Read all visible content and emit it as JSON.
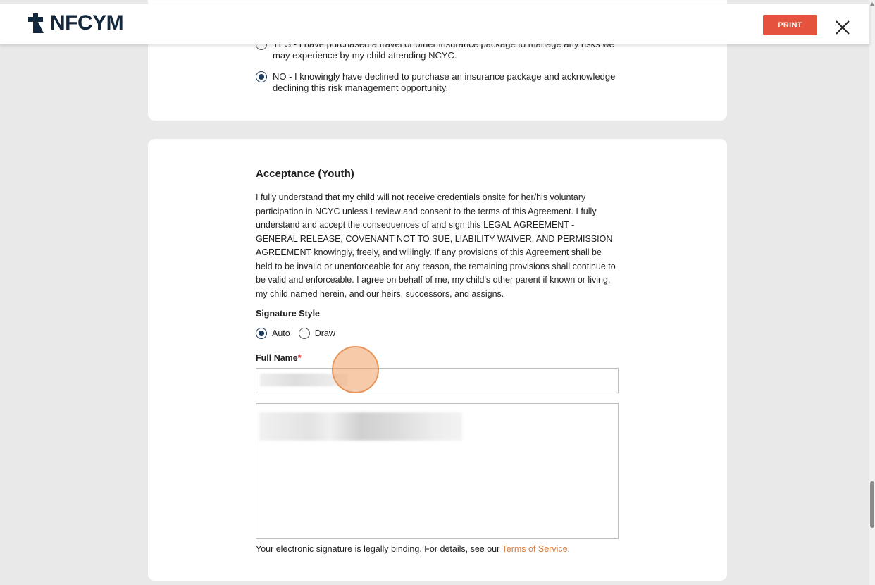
{
  "header": {
    "logo_text": "NFCYM",
    "print_label": "PRINT",
    "brand_color": "#14283d",
    "print_color": "#e5533f"
  },
  "insurance": {
    "yes_option": "YES - I have purchased a travel or other insurance package to manage any risks we may experience by my child attending NCYC.",
    "no_option": "NO - I knowingly have declined to purchase an insurance package and acknowledge declining this risk management opportunity.",
    "selected": "no"
  },
  "acceptance": {
    "heading": "Acceptance (Youth)",
    "body": "I fully understand that my child will not receive credentials onsite for her/his voluntary participation in NCYC unless I review and consent to the terms of this Agreement. I fully understand and accept the consequences of and sign this LEGAL AGREEMENT - GENERAL RELEASE, COVENANT NOT TO SUE, LIABILITY WAIVER, AND PERMISSION AGREEMENT knowingly, freely, and willingly. If any provisions of this Agreement shall be held to be invalid or unenforceable for any reason, the remaining provisions shall continue to be valid and enforceable. I agree on behalf of me, my child's other parent if known or living, my child named herein, and our heirs, successors, and assigns.",
    "signature_style_label": "Signature Style",
    "signature_options": [
      "Auto",
      "Draw"
    ],
    "signature_selected": "Auto",
    "full_name_label": "Full Name",
    "required_mark": "*",
    "disclaimer_text": "Your electronic signature is legally binding. For details, see our ",
    "tos_link": "Terms of Service",
    "disclaimer_end": ".",
    "link_color": "#d77a3c"
  }
}
